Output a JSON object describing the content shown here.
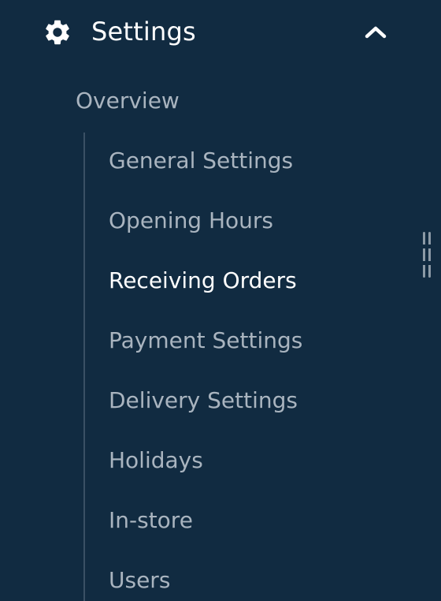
{
  "sidebar": {
    "section": {
      "title": "Settings",
      "icon": "gear-icon",
      "expand_icon": "chevron-up-icon",
      "expanded": true
    },
    "overview_label": "Overview",
    "items": [
      {
        "label": "General Settings",
        "active": false
      },
      {
        "label": "Opening Hours",
        "active": false
      },
      {
        "label": "Receiving Orders",
        "active": true
      },
      {
        "label": "Payment Settings",
        "active": false
      },
      {
        "label": "Delivery Settings",
        "active": false
      },
      {
        "label": "Holidays",
        "active": false
      },
      {
        "label": "In-store",
        "active": false
      },
      {
        "label": "Users",
        "active": false
      }
    ]
  },
  "colors": {
    "background": "#112b41",
    "text_active": "#ffffff",
    "text_muted": "#a9b4bf",
    "guide_line": "#3a5064"
  }
}
